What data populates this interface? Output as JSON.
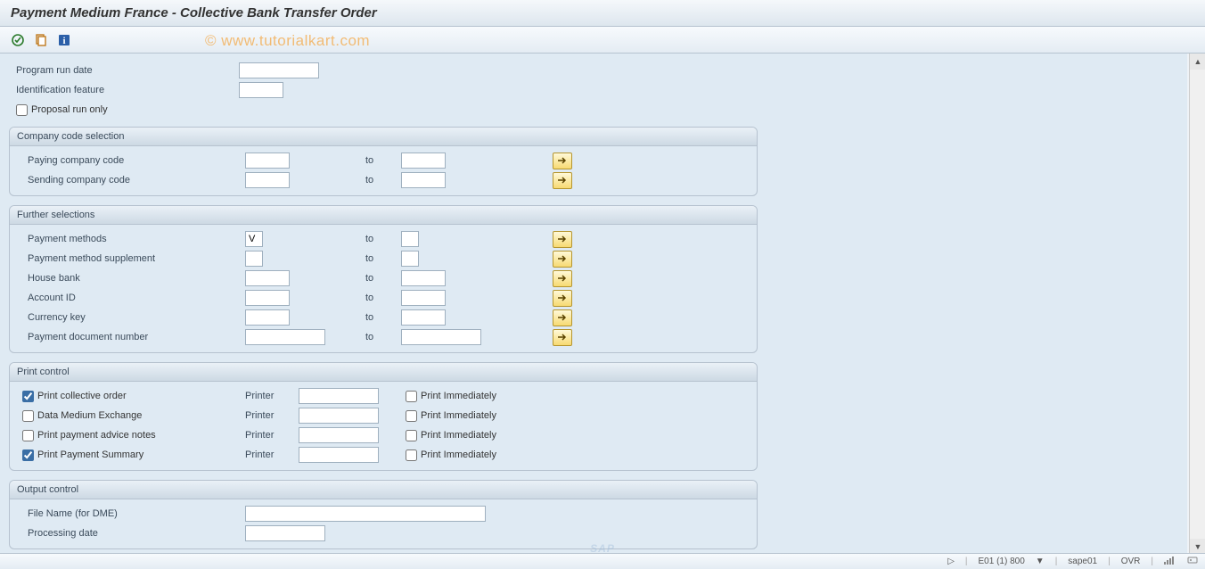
{
  "title": "Payment Medium France - Collective Bank Transfer Order",
  "watermark": "© www.tutorialkart.com",
  "top_fields": {
    "program_run_date_label": "Program run date",
    "identification_feature_label": "Identification feature",
    "proposal_run_only_label": "Proposal run only"
  },
  "to_label": "to",
  "groups": {
    "company_code": {
      "title": "Company code selection",
      "paying_label": "Paying company code",
      "sending_label": "Sending company code"
    },
    "further": {
      "title": "Further selections",
      "payment_methods_label": "Payment methods",
      "payment_methods_value": "V",
      "payment_supplement_label": "Payment method supplement",
      "house_bank_label": "House bank",
      "account_id_label": "Account ID",
      "currency_key_label": "Currency key",
      "payment_doc_label": "Payment document number"
    },
    "print_control": {
      "title": "Print control",
      "printer_label": "Printer",
      "immediate_label": "Print Immediately",
      "rows": [
        {
          "label": "Print collective order",
          "checked": true
        },
        {
          "label": "Data Medium Exchange",
          "checked": false
        },
        {
          "label": "Print payment advice notes",
          "checked": false
        },
        {
          "label": "Print Payment Summary",
          "checked": true
        }
      ]
    },
    "output_control": {
      "title": "Output control",
      "file_name_label": "File Name (for DME)",
      "processing_date_label": "Processing date"
    }
  },
  "status": {
    "system": "E01 (1) 800",
    "server": "sape01",
    "mode": "OVR"
  }
}
